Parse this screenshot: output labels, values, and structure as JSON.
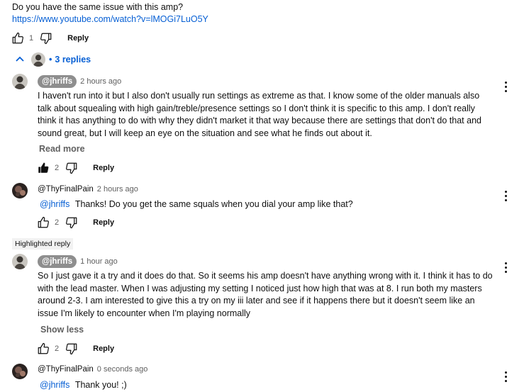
{
  "top_comment": {
    "text": "Do you have the same issue with this amp?",
    "link": "https://www.youtube.com/watch?v=lMOGi7LuO5Y",
    "likes": "1",
    "reply_label": "Reply"
  },
  "replies_toggle": {
    "label": "3 replies"
  },
  "comments": [
    {
      "author": "@jhriffs",
      "time": "2 hours ago",
      "text": "I haven't run into it but I also don't usually run settings as extreme as that. I know some of the older manuals also talk about squealing with high gain/treble/presence settings so I don't think it is specific to this amp. I don't really think it has anything to do with why they didn't market it that way because there are settings that don't do that and sound great, but I will keep an eye on the situation and see what he finds out about it.",
      "more_label": "Read more",
      "likes": "2",
      "reply_label": "Reply"
    },
    {
      "author": "@ThyFinalPain",
      "time": "2 hours ago",
      "mention": "@jhriffs",
      "text": "Thanks! Do you get the same squals when you dial your amp like that?",
      "likes": "2",
      "reply_label": "Reply"
    },
    {
      "badge": "Highlighted reply",
      "author": "@jhriffs",
      "time": "1 hour ago",
      "text": "So I just gave it a try and it does do that. So it seems his amp doesn't have anything wrong with it. I think it has to do with the lead master. When I was adjusting my setting I noticed just how high that was at 8. I run both my masters around 2-3. I am interested to give this a try on my iii later and see if it happens there but it doesn't seem like an issue I'm likely to encounter when I'm playing normally",
      "more_label": "Show less",
      "likes": "2",
      "reply_label": "Reply"
    },
    {
      "author": "@ThyFinalPain",
      "time": "0 seconds ago",
      "mention": "@jhriffs",
      "text": "Thank you! ;)"
    }
  ],
  "colors": {
    "link": "#065fd4",
    "meta": "#606060",
    "chip": "#8e8e8e"
  }
}
